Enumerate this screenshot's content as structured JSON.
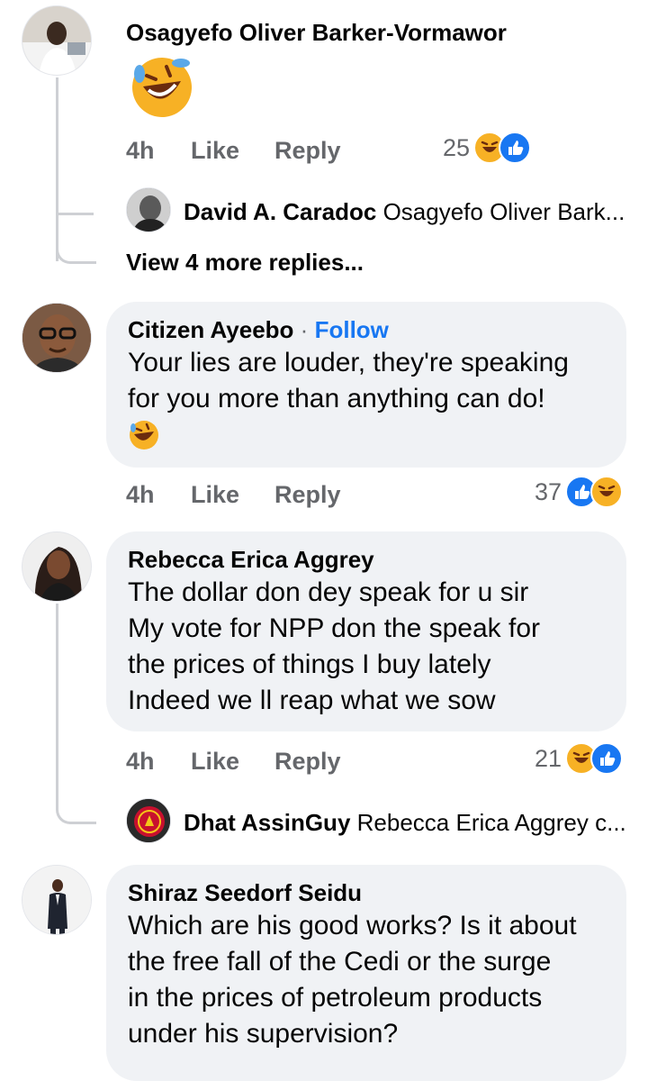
{
  "comments": [
    {
      "author": "Osagyefo Oliver Barker-Vormawor",
      "body_emoji": "rolling-on-floor-laughing",
      "time": "4h",
      "like": "Like",
      "reply": "Reply",
      "reaction_count": "25",
      "reactions": [
        "haha",
        "like"
      ],
      "replies": [
        {
          "author": "David A. Caradoc",
          "text": "Osagyefo Oliver Bark..."
        }
      ],
      "view_more": "View 4 more replies..."
    },
    {
      "author": "Citizen Ayeebo",
      "follow": "Follow",
      "dot": "·",
      "text_lines": [
        "Your lies are louder, they're speaking",
        "for you more than anything can do!"
      ],
      "body_emoji": "rolling-on-floor-laughing",
      "time": "4h",
      "like": "Like",
      "reply": "Reply",
      "reaction_count": "37",
      "reactions": [
        "like",
        "haha"
      ]
    },
    {
      "author": "Rebecca Erica Aggrey",
      "text_lines": [
        "The dollar don dey speak for u sir",
        "My vote for NPP don the speak for",
        "the prices of things I buy lately",
        "Indeed we ll reap what we sow"
      ],
      "time": "4h",
      "like": "Like",
      "reply": "Reply",
      "reaction_count": "21",
      "reactions": [
        "haha",
        "like"
      ],
      "replies": [
        {
          "author": "Dhat AssinGuy",
          "text": "Rebecca Erica Aggrey c..."
        }
      ]
    },
    {
      "author": "Shiraz Seedorf Seidu",
      "text_lines": [
        "Which are his good works? Is it about",
        "the free fall of the Cedi or the surge",
        "in the prices of petroleum products",
        "under his supervision?"
      ]
    }
  ],
  "colors": {
    "link": "#1877f2",
    "bubble": "#f0f2f5",
    "muted": "#65676b",
    "like": "#1877f2",
    "haha": "#f7b125"
  }
}
